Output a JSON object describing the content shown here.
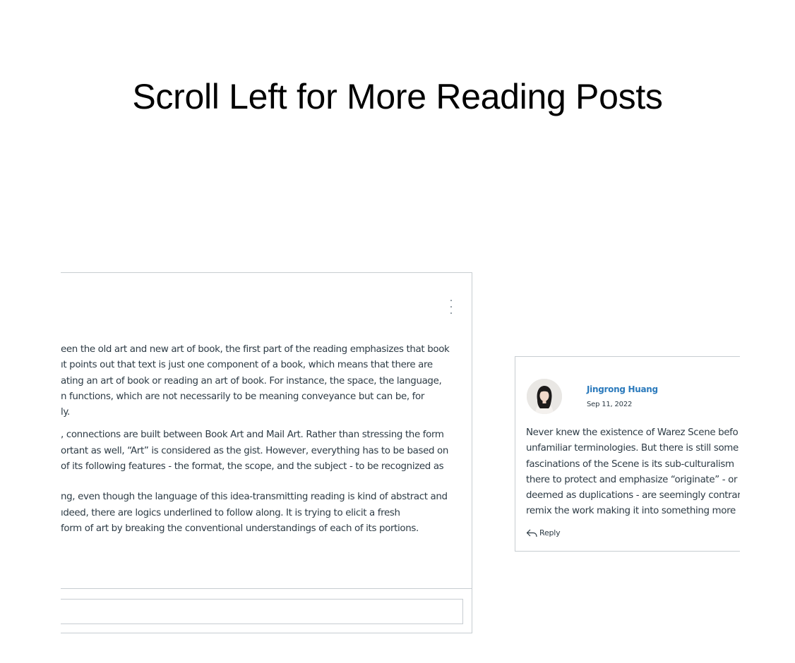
{
  "heading": "Scroll Left for More Reading Posts",
  "post": {
    "menu_icon": "kebab-menu-icon",
    "paragraphs": [
      [
        "een the old art and new art of book, the first part of the reading emphasizes that book",
        "ıt points out that text is just one component of a book, which means that  there are",
        "ating an art of book or reading an art of book. For instance, the space, the language,",
        "n functions, which are not necessarily to be meaning conveyance but can be, for",
        "ly."
      ],
      [
        ", connections are built between Book Art and Mail Art. Rather than stressing the form",
        "ortant as well, “Art” is considered as the gist. However, everything has to be based on",
        " of its following features - the format, the scope, and the subject - to be recognized as"
      ],
      [
        "ng, even though the language of this idea-transmitting reading is kind of abstract and",
        "ıdeed, there are logics underlined to follow along. It is trying to elicit a fresh",
        " form of art by breaking the conventional understandings of each of its portions."
      ]
    ]
  },
  "reply": {
    "author": "Jingrong Huang",
    "date": "Sep 11, 2022",
    "lines": [
      "Never knew the existence of Warez Scene befo",
      "unfamiliar terminologies. But there is still some",
      "fascinations of the Scene is its sub-culturalism",
      "there to protect and emphasize “originate” - or",
      "deemed as duplications - are seemingly contrar",
      "remix the work making it into something more"
    ],
    "reply_label": "Reply",
    "reply_icon": "reply-arrow-icon"
  }
}
